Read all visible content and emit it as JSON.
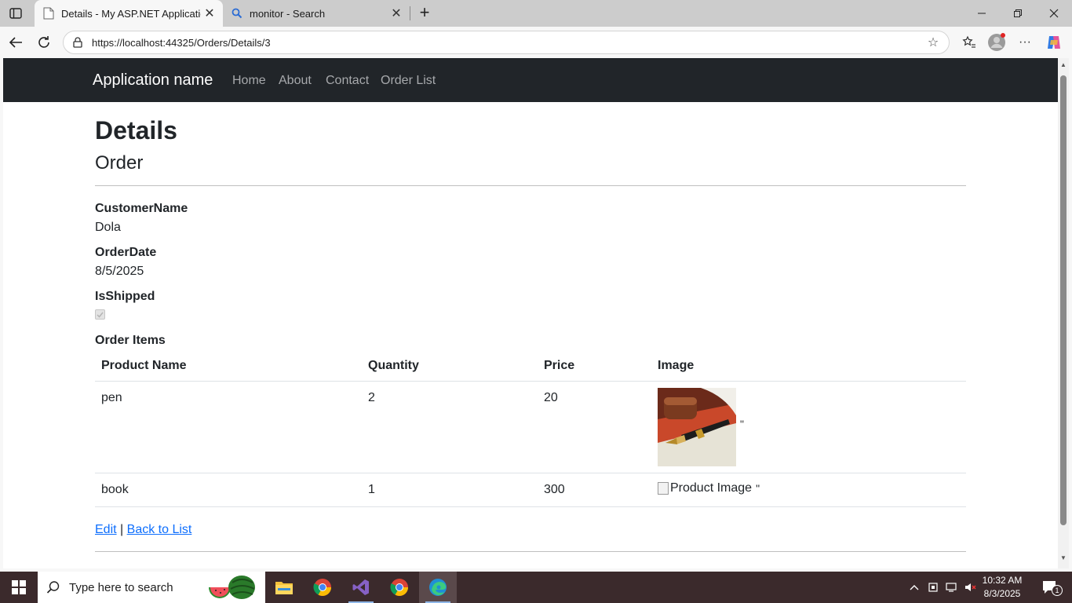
{
  "browser": {
    "tabs": [
      {
        "title": "Details - My ASP.NET Application",
        "icon": "page-icon",
        "active": true
      },
      {
        "title": "monitor - Search",
        "icon": "search-icon",
        "active": false
      }
    ],
    "url": "https://localhost:44325/Orders/Details/3"
  },
  "navbar": {
    "brand": "Application name",
    "links": [
      "Home",
      "About",
      "Contact",
      "Order List"
    ]
  },
  "page": {
    "title": "Details",
    "subtitle": "Order",
    "fields": {
      "customer_label": "CustomerName",
      "customer_value": "Dola",
      "date_label": "OrderDate",
      "date_value": "8/5/2025",
      "shipped_label": "IsShipped",
      "shipped_value": true
    },
    "items_label": "Order Items",
    "table": {
      "headers": [
        "Product Name",
        "Quantity",
        "Price",
        "Image"
      ],
      "rows": [
        {
          "name": "pen",
          "quantity": "2",
          "price": "20",
          "image": "pen-photo",
          "suffix": "\""
        },
        {
          "name": "book",
          "quantity": "1",
          "price": "300",
          "image_alt": "Product Image",
          "suffix": "\""
        }
      ]
    },
    "actions": {
      "edit": "Edit",
      "separator": "|",
      "back": "Back to List"
    }
  },
  "taskbar": {
    "search_placeholder": "Type here to search",
    "time": "10:32 AM",
    "date": "8/3/2025",
    "notification_count": "1",
    "apps": [
      "file-explorer-icon",
      "chrome-icon",
      "visual-studio-icon",
      "chrome-icon",
      "edge-icon"
    ]
  }
}
